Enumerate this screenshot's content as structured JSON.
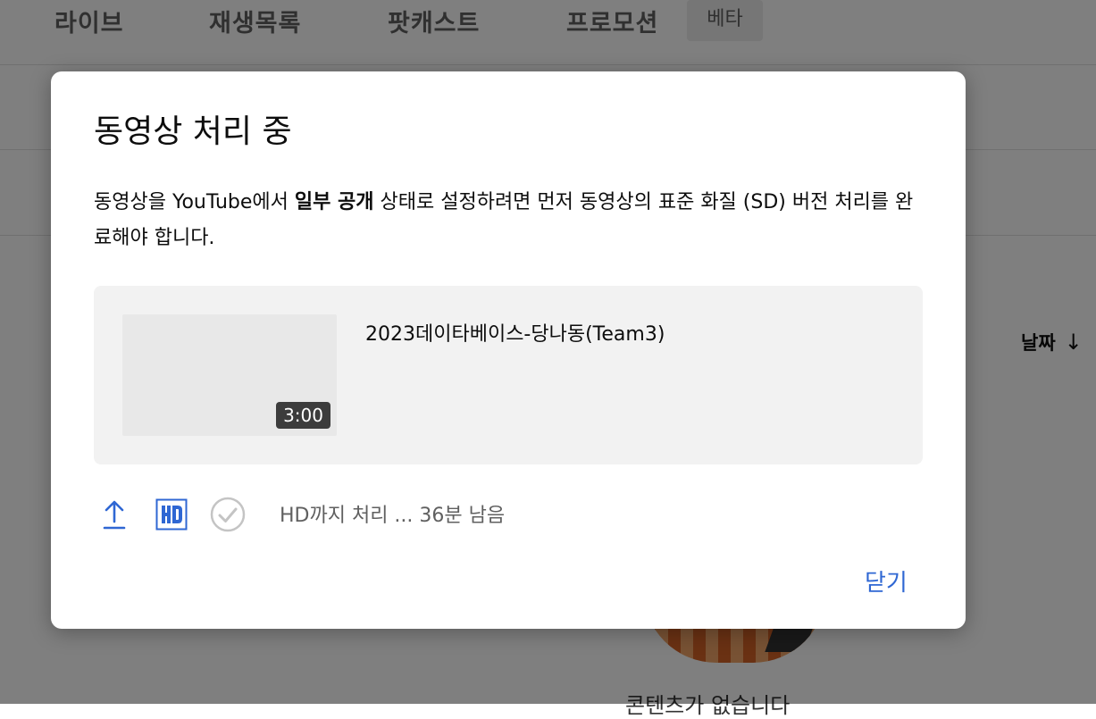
{
  "background": {
    "tabs": [
      {
        "label": "라이브"
      },
      {
        "label": "재생목록"
      },
      {
        "label": "팟캐스트"
      },
      {
        "label": "프로모션"
      }
    ],
    "beta_badge": "베타",
    "date_column": "날짜",
    "date_sort_icon": "arrow-down-icon",
    "empty_state_text": "콘텐츠가 없습니다"
  },
  "dialog": {
    "title": "동영상 처리 중",
    "description_part1": "동영상을 YouTube에서 ",
    "description_bold": "일부 공개",
    "description_part2": " 상태로 설정하려면 먼저 동영상의 표준 화질 (SD) 버전 처리를 완료해야 합니다.",
    "video": {
      "title": "2023데이타베이스-당나동(Team3)",
      "duration": "3:00"
    },
    "status": {
      "icons": [
        "upload-icon",
        "hd-icon",
        "check-circle-icon"
      ],
      "text": "HD까지 처리 ... 36분 남음"
    },
    "close_label": "닫기",
    "accent_color": "#2f67d3"
  }
}
